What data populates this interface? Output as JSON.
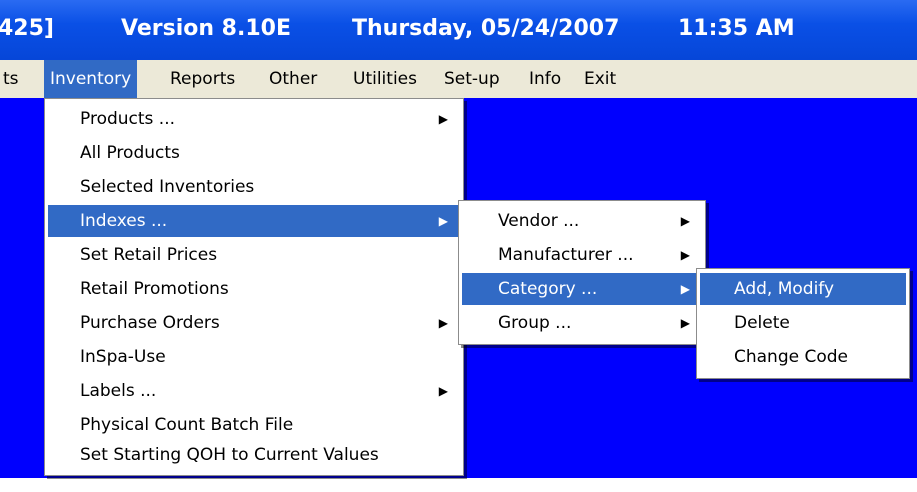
{
  "titlebar": {
    "left_fragment": "425]",
    "version": "Version 8.10E",
    "date": "Thursday, 05/24/2007",
    "time": "11:35 AM"
  },
  "menubar": {
    "items": [
      {
        "label": "ts",
        "active": false
      },
      {
        "label": "Inventory",
        "active": true
      },
      {
        "label": "Reports",
        "active": false
      },
      {
        "label": "Other",
        "active": false
      },
      {
        "label": "Utilities",
        "active": false
      },
      {
        "label": "Set-up",
        "active": false
      },
      {
        "label": "Info",
        "active": false
      },
      {
        "label": "Exit",
        "active": false
      }
    ]
  },
  "inventory_menu": {
    "items": [
      {
        "label": "Products ...",
        "has_submenu": true,
        "highlighted": false
      },
      {
        "label": "All Products",
        "has_submenu": false,
        "highlighted": false
      },
      {
        "label": "Selected Inventories",
        "has_submenu": false,
        "highlighted": false
      },
      {
        "label": "Indexes ...",
        "has_submenu": true,
        "highlighted": true
      },
      {
        "label": "Set Retail Prices",
        "has_submenu": false,
        "highlighted": false
      },
      {
        "label": "Retail Promotions",
        "has_submenu": false,
        "highlighted": false
      },
      {
        "label": "Purchase Orders",
        "has_submenu": true,
        "highlighted": false
      },
      {
        "label": "InSpa-Use",
        "has_submenu": false,
        "highlighted": false
      },
      {
        "label": "Labels ...",
        "has_submenu": true,
        "highlighted": false
      },
      {
        "label": "Physical Count Batch File",
        "has_submenu": false,
        "highlighted": false
      },
      {
        "label": "Set Starting QOH to Current Values",
        "has_submenu": false,
        "highlighted": false
      }
    ]
  },
  "indexes_menu": {
    "items": [
      {
        "label": "Vendor ...",
        "has_submenu": true,
        "highlighted": false
      },
      {
        "label": "Manufacturer ...",
        "has_submenu": true,
        "highlighted": false
      },
      {
        "label": "Category ...",
        "has_submenu": true,
        "highlighted": true
      },
      {
        "label": "Group ...",
        "has_submenu": true,
        "highlighted": false
      }
    ]
  },
  "category_menu": {
    "items": [
      {
        "label": "Add, Modify",
        "highlighted": true
      },
      {
        "label": "Delete",
        "highlighted": false
      },
      {
        "label": "Change Code",
        "highlighted": false
      }
    ]
  },
  "colors": {
    "titlebar": "#0a50e6",
    "menubar": "#ece9d8",
    "desktop": "#0000fe",
    "highlight": "#316ac5",
    "menu_bg": "#ffffff"
  },
  "icons": {
    "submenu_arrow": "triangle-right-icon"
  }
}
